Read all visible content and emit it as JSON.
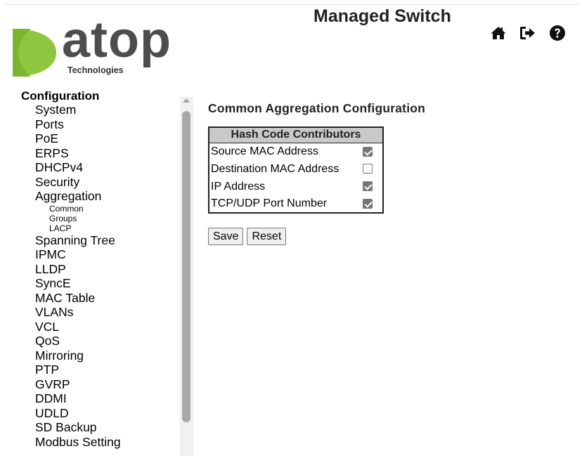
{
  "header": {
    "title": "Managed Switch",
    "logo": {
      "word": "atop",
      "sub": "Technologies"
    },
    "icons": [
      "home-icon",
      "logout-icon",
      "help-icon"
    ]
  },
  "sidebar": {
    "heading": "Configuration",
    "items": [
      {
        "label": "System"
      },
      {
        "label": "Ports"
      },
      {
        "label": "PoE"
      },
      {
        "label": "ERPS"
      },
      {
        "label": "DHCPv4"
      },
      {
        "label": "Security"
      },
      {
        "label": "Aggregation"
      },
      {
        "label": "Common",
        "sub": true
      },
      {
        "label": "Groups",
        "sub": true
      },
      {
        "label": "LACP",
        "sub": true
      },
      {
        "label": "Spanning Tree"
      },
      {
        "label": "IPMC"
      },
      {
        "label": "LLDP"
      },
      {
        "label": "SyncE"
      },
      {
        "label": "MAC Table"
      },
      {
        "label": "VLANs"
      },
      {
        "label": "VCL"
      },
      {
        "label": "QoS"
      },
      {
        "label": "Mirroring"
      },
      {
        "label": "PTP"
      },
      {
        "label": "GVRP"
      },
      {
        "label": "DDMI"
      },
      {
        "label": "UDLD"
      },
      {
        "label": "SD Backup"
      },
      {
        "label": "Modbus Setting"
      }
    ]
  },
  "main": {
    "title": "Common Aggregation Configuration",
    "table": {
      "header": "Hash Code Contributors",
      "rows": [
        {
          "label": "Source MAC Address",
          "checked": true
        },
        {
          "label": "Destination MAC Address",
          "checked": false
        },
        {
          "label": "IP Address",
          "checked": true
        },
        {
          "label": "TCP/UDP Port Number",
          "checked": true
        }
      ]
    },
    "buttons": {
      "save": "Save",
      "reset": "Reset"
    }
  },
  "colors": {
    "logo_green": "#8dc63f",
    "logo_text": "#4d4d4d",
    "table_header_bg": "#c9c9c9"
  }
}
